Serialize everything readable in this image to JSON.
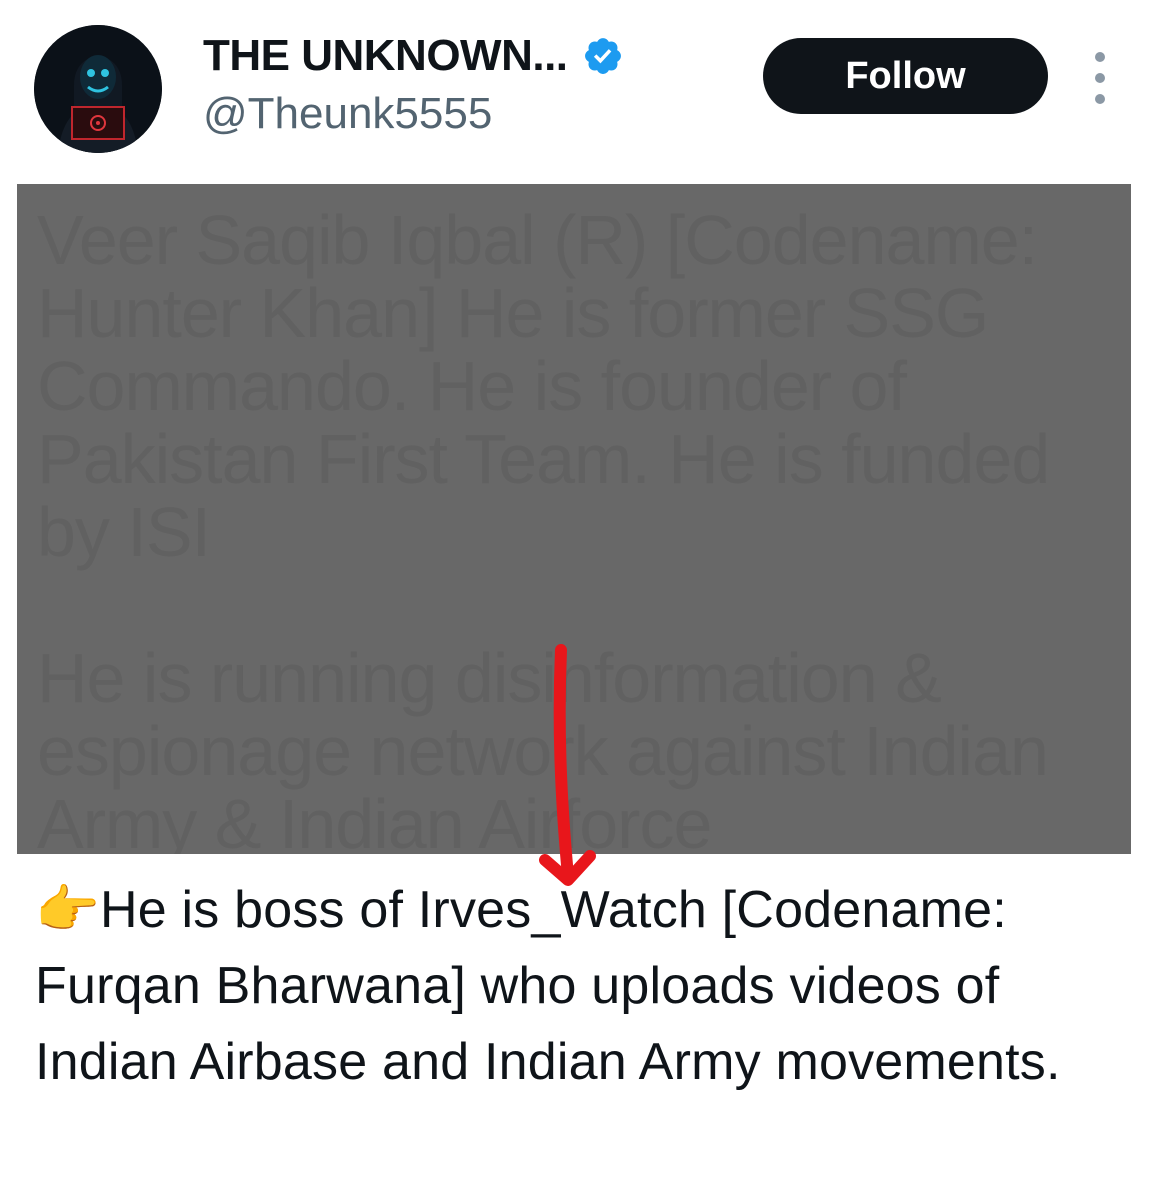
{
  "header": {
    "display_name": "THE UNKNOWN...",
    "handle": "@Theunk5555",
    "verified_icon": "verified-badge-icon",
    "follow_label": "Follow",
    "more_icon": "more-vertical-icon"
  },
  "media": {
    "obscured_text": "Veer Saqib Iqbal (R) [Codename: Hunter Khan] He is former SSG Commando. He is founder of Pakistan First Team. He is funded by ISI\n\nHe is running disinformation & espionage network against Indian Army & Indian Airforce",
    "overlay_color": "#686868"
  },
  "annotation": {
    "arrow_color": "#e8161b",
    "arrow_icon": "red-arrow-down-icon"
  },
  "tweet": {
    "emoji": "👉",
    "text": "He is boss of Irves_Watch [Codename: Furqan Bharwana] who uploads videos of Indian Airbase and Indian Army movements."
  },
  "colors": {
    "accent": "#1d9bf0",
    "text_primary": "#0f1419",
    "text_secondary": "#536471",
    "button_bg": "#0f1419"
  }
}
